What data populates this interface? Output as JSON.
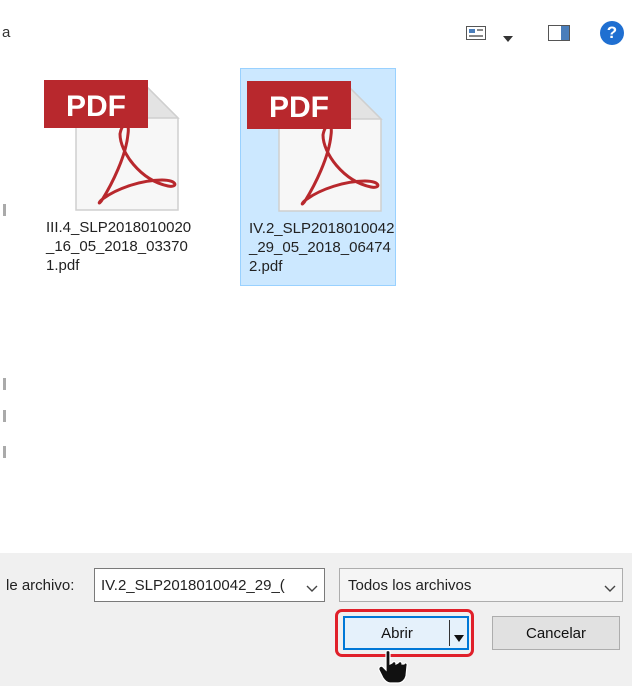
{
  "toolbar": {
    "partial_text": "a",
    "view_icon": "view-options-icon",
    "chevron_icon": "chevron-down-icon",
    "pane_icon": "preview-pane-icon",
    "help_icon": "help-icon",
    "help_glyph": "?"
  },
  "files": [
    {
      "name": "III.4_SLP2018010020_16_05_2018_033701.pdf",
      "icon_label": "PDF",
      "selected": false
    },
    {
      "name": "IV.2_SLP2018010042_29_05_2018_064742.pdf",
      "icon_label": "PDF",
      "selected": true
    }
  ],
  "bottom": {
    "filename_label": "le archivo:",
    "filename_value": "IV.2_SLP2018010042_29_(",
    "filter_value": "Todos los archivos",
    "open_label": "Abrir",
    "cancel_label": "Cancelar"
  },
  "colors": {
    "selection": "#cce8ff",
    "pdf_red": "#b8282d",
    "highlight": "#e0202a",
    "accent": "#0078d7"
  }
}
